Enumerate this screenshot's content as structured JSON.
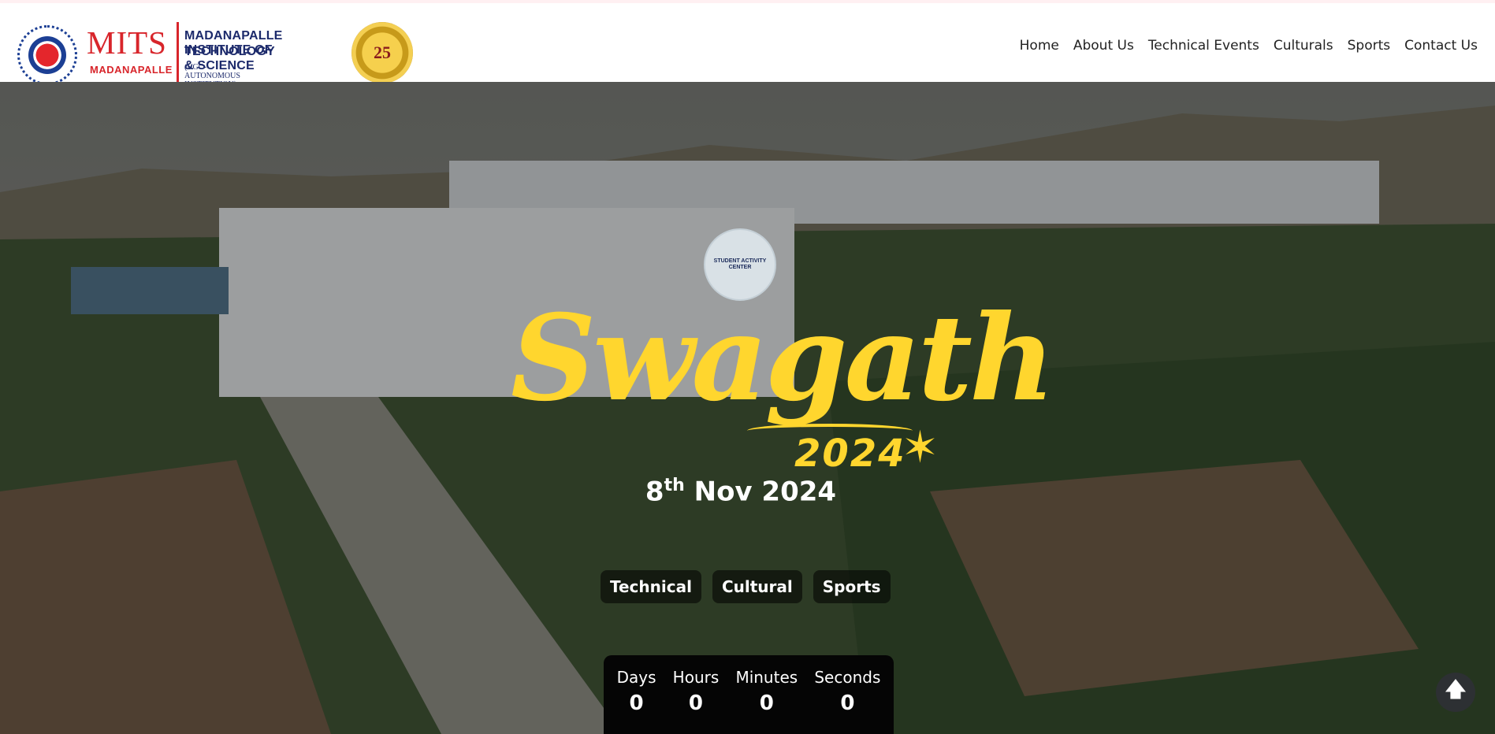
{
  "header": {
    "logo": {
      "mits": "MITS",
      "mits_sub": "MADANAPALLE",
      "institute_line1": "MADANAPALLE INSTITUTE OF",
      "institute_line2": "TECHNOLOGY & SCIENCE",
      "institute_line3": "(UGC-AUTONOMOUS INSTITUTION)",
      "badge_text": "25"
    },
    "nav": [
      "Home",
      "About Us",
      "Technical Events",
      "Culturals",
      "Sports",
      "Contact Us"
    ]
  },
  "hero": {
    "sac_badge": "STUDENT ACTIVITY CENTER",
    "event_name": "Swagath",
    "event_year": "2024",
    "date_day": "8",
    "date_suffix": "th",
    "date_rest": " Nov 2024",
    "categories": [
      "Technical",
      "Cultural",
      "Sports"
    ],
    "countdown": [
      {
        "label": "Days",
        "value": "0"
      },
      {
        "label": "Hours",
        "value": "0"
      },
      {
        "label": "Minutes",
        "value": "0"
      },
      {
        "label": "Seconds",
        "value": "0"
      }
    ]
  },
  "colors": {
    "accent": "#ffd62e",
    "brand_red": "#d8252b",
    "brand_blue": "#1c2a6b"
  },
  "icons": {
    "scroll_top": "arrow-up-icon"
  }
}
